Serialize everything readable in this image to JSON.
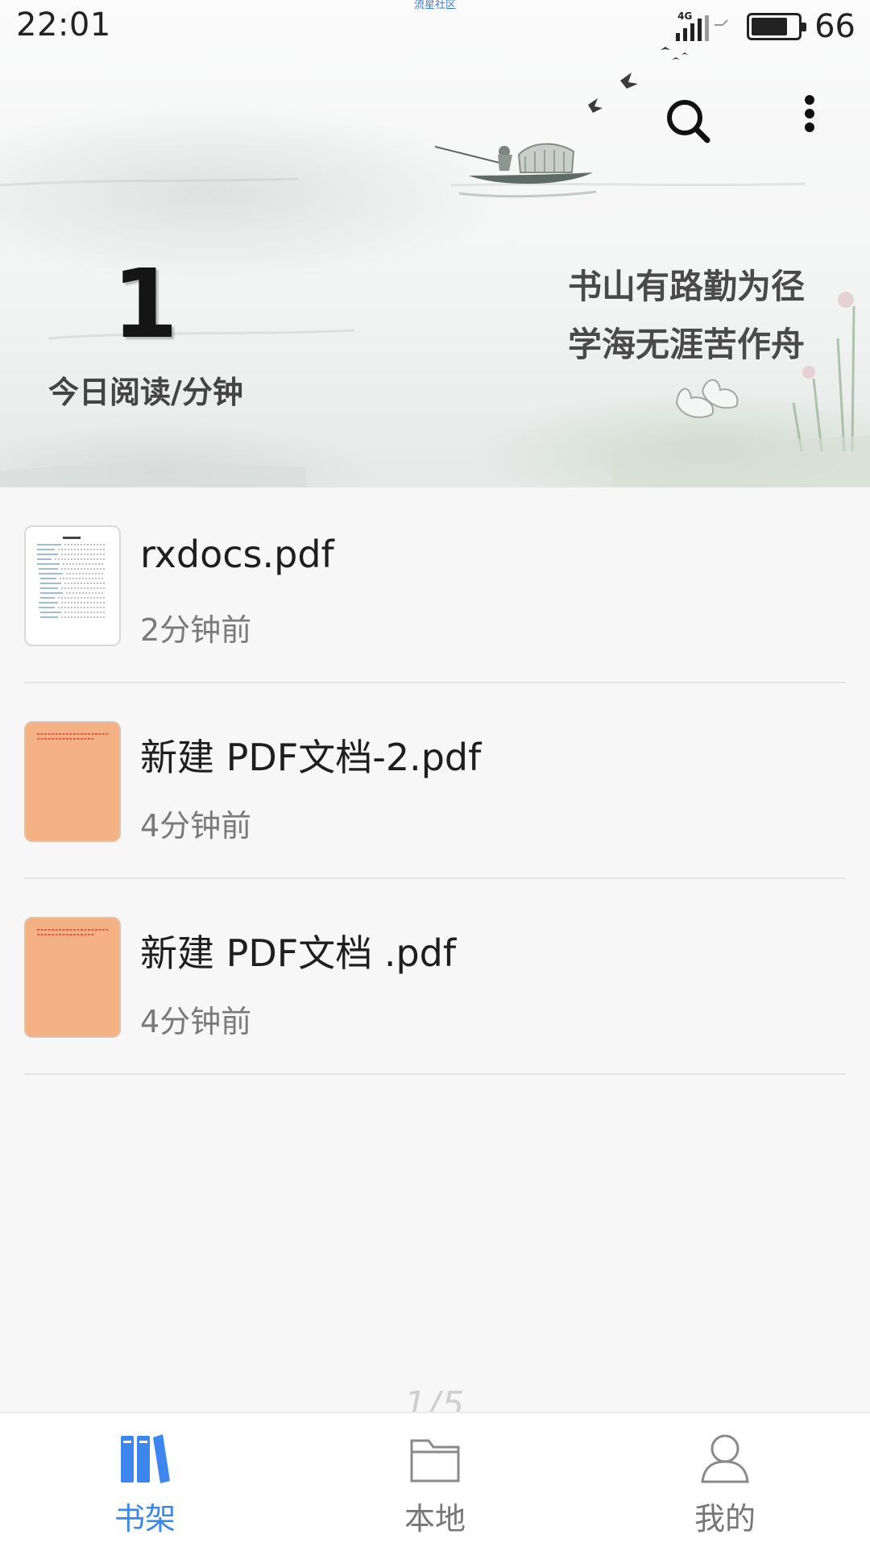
{
  "watermark": "流星社区",
  "status_bar": {
    "time": "22:01",
    "network": "4G",
    "battery_level": "66"
  },
  "header": {
    "today_read_minutes": "1",
    "today_read_label": "今日阅读/分钟",
    "motto_line1": "书山有路勤为径",
    "motto_line2": "学海无涯苦作舟"
  },
  "books": [
    {
      "title": "rxdocs.pdf",
      "time": "2分钟前",
      "thumb": "white"
    },
    {
      "title": "新建 PDF文档-2.pdf",
      "time": "4分钟前",
      "thumb": "orange"
    },
    {
      "title": "新建 PDF文档 .pdf",
      "time": "4分钟前",
      "thumb": "orange"
    }
  ],
  "page_indicator": "1/5",
  "bottom_nav": [
    {
      "label": "书架",
      "icon": "bookshelf-icon",
      "active": true
    },
    {
      "label": "本地",
      "icon": "folder-icon",
      "active": false
    },
    {
      "label": "我的",
      "icon": "user-icon",
      "active": false
    }
  ],
  "colors": {
    "accent": "#3d86f0",
    "thumb_orange": "#f4b183",
    "background": "#f7f7f7"
  }
}
